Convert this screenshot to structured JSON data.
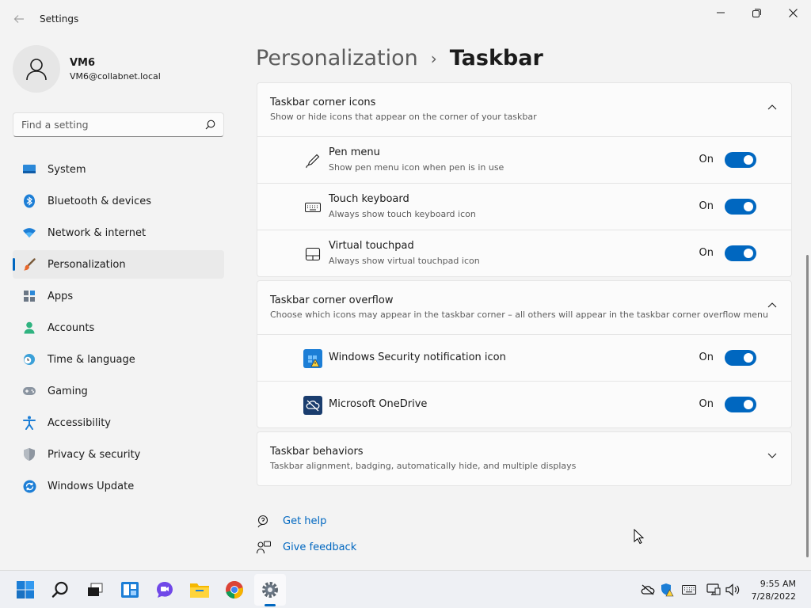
{
  "window": {
    "title": "Settings",
    "back_icon": "back-arrow-icon",
    "minimize_icon": "minimize-icon",
    "maximize_icon": "restore-icon",
    "close_icon": "close-icon"
  },
  "profile": {
    "name": "VM6",
    "email": "VM6@collabnet.local"
  },
  "search": {
    "placeholder": "Find a setting"
  },
  "sidebar": {
    "items": [
      {
        "label": "System",
        "icon": "system-icon",
        "active": false
      },
      {
        "label": "Bluetooth & devices",
        "icon": "bluetooth-icon",
        "active": false
      },
      {
        "label": "Network & internet",
        "icon": "network-icon",
        "active": false
      },
      {
        "label": "Personalization",
        "icon": "personalization-brush-icon",
        "active": true
      },
      {
        "label": "Apps",
        "icon": "apps-icon",
        "active": false
      },
      {
        "label": "Accounts",
        "icon": "accounts-icon",
        "active": false
      },
      {
        "label": "Time & language",
        "icon": "time-language-icon",
        "active": false
      },
      {
        "label": "Gaming",
        "icon": "gaming-icon",
        "active": false
      },
      {
        "label": "Accessibility",
        "icon": "accessibility-icon",
        "active": false
      },
      {
        "label": "Privacy & security",
        "icon": "privacy-shield-icon",
        "active": false
      },
      {
        "label": "Windows Update",
        "icon": "windows-update-icon",
        "active": false
      }
    ]
  },
  "breadcrumb": {
    "parent": "Personalization",
    "separator": "›",
    "current": "Taskbar"
  },
  "corner_icons": {
    "title": "Taskbar corner icons",
    "desc": "Show or hide icons that appear on the corner of your taskbar",
    "items": [
      {
        "title": "Pen menu",
        "desc": "Show pen menu icon when pen is in use",
        "state": "On"
      },
      {
        "title": "Touch keyboard",
        "desc": "Always show touch keyboard icon",
        "state": "On"
      },
      {
        "title": "Virtual touchpad",
        "desc": "Always show virtual touchpad icon",
        "state": "On"
      }
    ]
  },
  "corner_overflow": {
    "title": "Taskbar corner overflow",
    "desc": "Choose which icons may appear in the taskbar corner – all others will appear in the taskbar corner overflow menu",
    "items": [
      {
        "title": "Windows Security notification icon",
        "state": "On"
      },
      {
        "title": "Microsoft OneDrive",
        "state": "On"
      }
    ]
  },
  "behaviors": {
    "title": "Taskbar behaviors",
    "desc": "Taskbar alignment, badging, automatically hide, and multiple displays"
  },
  "links": {
    "help": "Get help",
    "feedback": "Give feedback"
  },
  "colors": {
    "accent": "#0067c0",
    "background": "#f3f3f3",
    "card": "#fbfbfb"
  },
  "taskbar": {
    "apps": [
      "start-icon",
      "search-icon",
      "task-view-icon",
      "widgets-icon",
      "chat-icon",
      "file-explorer-icon",
      "chrome-icon",
      "settings-icon"
    ],
    "time": "9:55 AM",
    "date": "7/28/2022"
  }
}
